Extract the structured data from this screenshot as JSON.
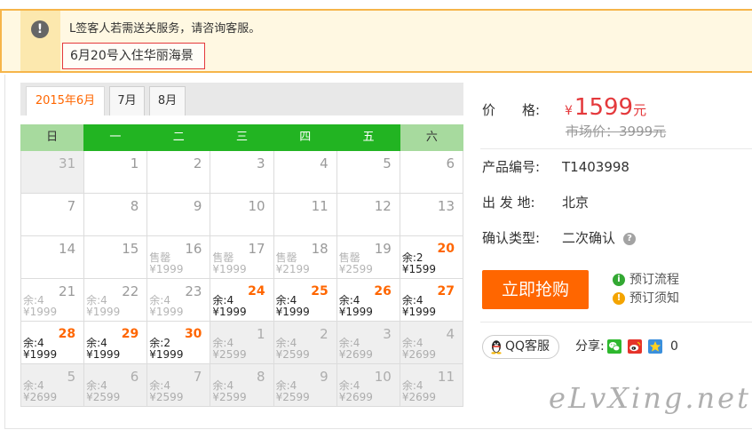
{
  "notice": {
    "icon": "exclamation-icon",
    "message": "L签客人若需送关服务，请咨询客服。",
    "highlight": "6月20号入住华丽海景"
  },
  "calendar": {
    "tabs": [
      {
        "label": "2015年6月",
        "active": true
      },
      {
        "label": "7月",
        "active": false
      },
      {
        "label": "8月",
        "active": false
      }
    ],
    "weekdays": [
      "日",
      "一",
      "二",
      "三",
      "四",
      "五",
      "六"
    ],
    "weeks": [
      [
        {
          "day": "31",
          "status": "other"
        },
        {
          "day": "1",
          "status": "past"
        },
        {
          "day": "2",
          "status": "past"
        },
        {
          "day": "3",
          "status": "past"
        },
        {
          "day": "4",
          "status": "past"
        },
        {
          "day": "5",
          "status": "past"
        },
        {
          "day": "6",
          "status": "past"
        }
      ],
      [
        {
          "day": "7",
          "status": "past"
        },
        {
          "day": "8",
          "status": "past"
        },
        {
          "day": "9",
          "status": "past"
        },
        {
          "day": "10",
          "status": "past"
        },
        {
          "day": "11",
          "status": "past"
        },
        {
          "day": "12",
          "status": "past"
        },
        {
          "day": "13",
          "status": "past"
        }
      ],
      [
        {
          "day": "14",
          "status": "past"
        },
        {
          "day": "15",
          "status": "past"
        },
        {
          "day": "16",
          "status": "soldout",
          "note": "售罄",
          "price": "¥1999"
        },
        {
          "day": "17",
          "status": "soldout",
          "note": "售罄",
          "price": "¥1999"
        },
        {
          "day": "18",
          "status": "soldout",
          "note": "售罄",
          "price": "¥2199"
        },
        {
          "day": "19",
          "status": "soldout",
          "note": "售罄",
          "price": "¥2599"
        },
        {
          "day": "20",
          "status": "available",
          "note": "余:2",
          "price": "¥1599"
        }
      ],
      [
        {
          "day": "21",
          "status": "closed",
          "note": "余:4",
          "price": "¥1999"
        },
        {
          "day": "22",
          "status": "closed",
          "note": "余:4",
          "price": "¥1999"
        },
        {
          "day": "23",
          "status": "closed",
          "note": "余:4",
          "price": "¥1999"
        },
        {
          "day": "24",
          "status": "available",
          "note": "余:4",
          "price": "¥1999"
        },
        {
          "day": "25",
          "status": "available",
          "note": "余:4",
          "price": "¥1999"
        },
        {
          "day": "26",
          "status": "available",
          "note": "余:4",
          "price": "¥1999"
        },
        {
          "day": "27",
          "status": "available",
          "note": "余:4",
          "price": "¥1999"
        }
      ],
      [
        {
          "day": "28",
          "status": "available",
          "note": "余:4",
          "price": "¥1999"
        },
        {
          "day": "29",
          "status": "available",
          "note": "余:4",
          "price": "¥1999"
        },
        {
          "day": "30",
          "status": "available",
          "note": "余:2",
          "price": "¥1999"
        },
        {
          "day": "1",
          "status": "other",
          "note": "余:4",
          "price": "¥2599"
        },
        {
          "day": "2",
          "status": "other",
          "note": "余:4",
          "price": "¥2599"
        },
        {
          "day": "3",
          "status": "other",
          "note": "余:4",
          "price": "¥2699"
        },
        {
          "day": "4",
          "status": "other",
          "note": "余:4",
          "price": "¥2699"
        }
      ],
      [
        {
          "day": "5",
          "status": "other",
          "note": "余:4",
          "price": "¥2699"
        },
        {
          "day": "6",
          "status": "other",
          "note": "余:4",
          "price": "¥2599"
        },
        {
          "day": "7",
          "status": "other",
          "note": "余:4",
          "price": "¥2599"
        },
        {
          "day": "8",
          "status": "other",
          "note": "余:4",
          "price": "¥2599"
        },
        {
          "day": "9",
          "status": "other",
          "note": "余:4",
          "price": "¥2599"
        },
        {
          "day": "10",
          "status": "other",
          "note": "余:4",
          "price": "¥2699"
        },
        {
          "day": "11",
          "status": "other",
          "note": "余:4",
          "price": "¥2699"
        }
      ]
    ]
  },
  "product": {
    "price": {
      "label": "价　　格:",
      "currency": "¥",
      "value": "1599",
      "unit": "元",
      "market": "市场价：3999元"
    },
    "code": {
      "label": "产品编号:",
      "value": "T1403998"
    },
    "departure": {
      "label": "出 发 地:",
      "value": "北京"
    },
    "confirm": {
      "label": "确认类型:",
      "value": "二次确认",
      "icon": "help-icon"
    },
    "buy_button": "立即抢购",
    "links": [
      {
        "label": "预订流程",
        "icon": "info-icon"
      },
      {
        "label": "预订须知",
        "icon": "warning-icon"
      }
    ]
  },
  "social": {
    "qq_label": "QQ客服",
    "qq_icon": "qq-penguin-icon",
    "share_label": "分享:",
    "share_icons": [
      "wechat-icon",
      "weibo-icon",
      "qzone-icon"
    ],
    "share_count": "0"
  },
  "watermark": "eLvXing.net",
  "colors": {
    "accent": "#ff6600",
    "price": "#e4393c",
    "header_green": "#22b422",
    "weekend_green": "#a7da9e"
  }
}
